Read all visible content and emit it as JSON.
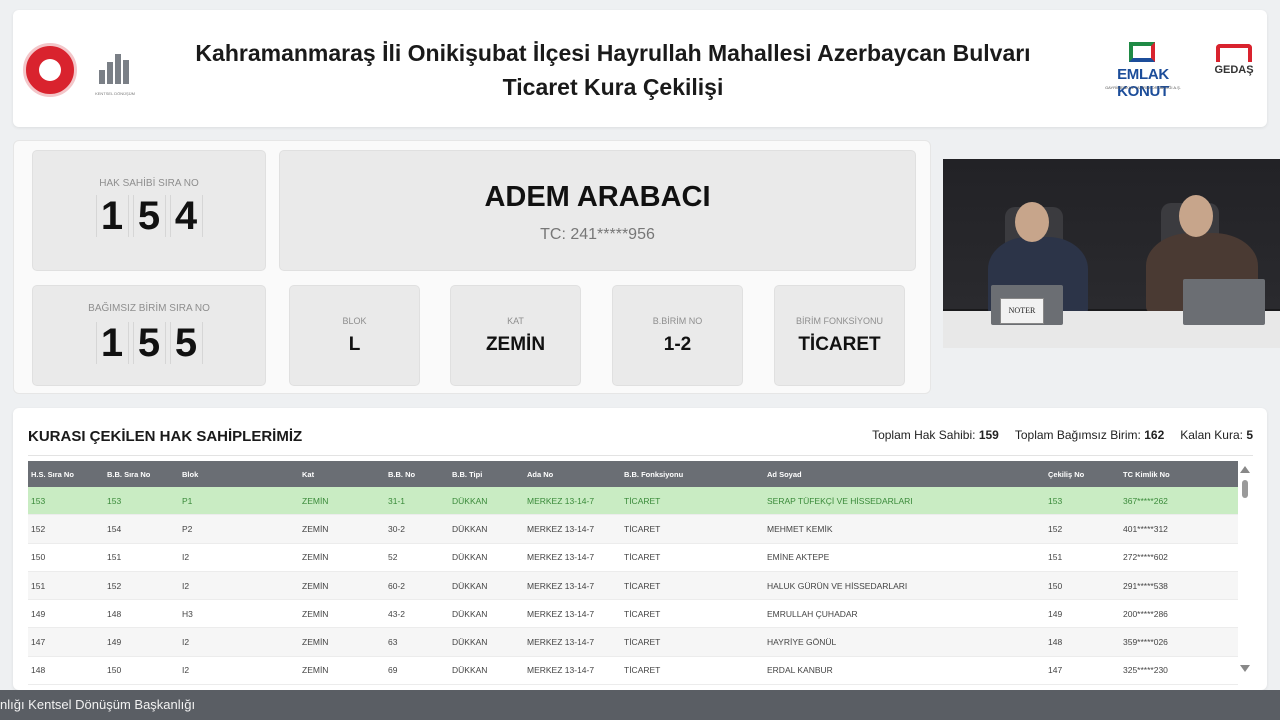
{
  "header": {
    "title_line1": "Kahramanmaraş İli Onikişubat İlçesi Hayrullah Mahallesi Azerbaycan Bulvarı",
    "title_line2": "Ticaret Kura Çekilişi",
    "logos": {
      "kentsel_caption": "KENTSEL DÖNÜŞÜM",
      "emlak_konut": "EMLAK KONUT",
      "emlak_konut_sub": "GAYRİMENKUL YATIRIM ORTAKLIĞI A.Ş.",
      "gedas": "GEDAŞ"
    }
  },
  "current": {
    "hak_sahibi_label": "HAK SAHİBİ SIRA NO",
    "hak_sahibi_digits": [
      "1",
      "5",
      "4"
    ],
    "bagimsiz_label": "BAĞIMSIZ BİRİM SIRA NO",
    "bagimsiz_digits": [
      "1",
      "5",
      "5"
    ],
    "name": "ADEM ARABACI",
    "tc": "TC: 241*****956",
    "blok_label": "BLOK",
    "blok": "L",
    "kat_label": "KAT",
    "kat": "ZEMİN",
    "bbirim_label": "B.BİRİM NO",
    "bbirim": "1-2",
    "fonksiyon_label": "BİRİM FONKSİYONU",
    "fonksiyon": "TİCARET"
  },
  "camera": {
    "noter_label": "NOTER"
  },
  "results": {
    "title": "KURASI ÇEKİLEN HAK SAHİPLERİMİZ",
    "stats": {
      "toplam_hak_label": "Toplam Hak Sahibi:",
      "toplam_hak": "159",
      "toplam_birim_label": "Toplam Bağımsız Birim:",
      "toplam_birim": "162",
      "kalan_label": "Kalan Kura:",
      "kalan": "5"
    },
    "columns": [
      "H.S. Sıra No",
      "B.B. Sıra No",
      "Blok",
      "Kat",
      "B.B. No",
      "B.B. Tipi",
      "Ada No",
      "B.B. Fonksiyonu",
      "Ad Soyad",
      "Çekiliş No",
      "TC Kimlik No"
    ],
    "rows": [
      [
        "153",
        "153",
        "P1",
        "ZEMİN",
        "31-1",
        "DÜKKAN",
        "MERKEZ 13-14-7",
        "TİCARET",
        "SERAP TÜFEKÇİ VE HİSSEDARLARI",
        "153",
        "367*****262"
      ],
      [
        "152",
        "154",
        "P2",
        "ZEMİN",
        "30-2",
        "DÜKKAN",
        "MERKEZ 13-14-7",
        "TİCARET",
        "MEHMET KEMİK",
        "152",
        "401*****312"
      ],
      [
        "150",
        "151",
        "I2",
        "ZEMİN",
        "52",
        "DÜKKAN",
        "MERKEZ 13-14-7",
        "TİCARET",
        "EMİNE AKTEPE",
        "151",
        "272*****602"
      ],
      [
        "151",
        "152",
        "I2",
        "ZEMİN",
        "60-2",
        "DÜKKAN",
        "MERKEZ 13-14-7",
        "TİCARET",
        "HALUK GÜRÜN VE HİSSEDARLARI",
        "150",
        "291*****538"
      ],
      [
        "149",
        "148",
        "H3",
        "ZEMİN",
        "43-2",
        "DÜKKAN",
        "MERKEZ 13-14-7",
        "TİCARET",
        "EMRULLAH ÇUHADAR",
        "149",
        "200*****286"
      ],
      [
        "147",
        "149",
        "I2",
        "ZEMİN",
        "63",
        "DÜKKAN",
        "MERKEZ 13-14-7",
        "TİCARET",
        "HAYRİYE GÖNÜL",
        "148",
        "359*****026"
      ],
      [
        "148",
        "150",
        "I2",
        "ZEMİN",
        "69",
        "DÜKKAN",
        "MERKEZ 13-14-7",
        "TİCARET",
        "ERDAL KANBUR",
        "147",
        "325*****230"
      ]
    ],
    "highlight_color": "#c9ecc3"
  },
  "ticker": {
    "text": "nlığı Kentsel Dönüşüm Başkanlığı"
  }
}
